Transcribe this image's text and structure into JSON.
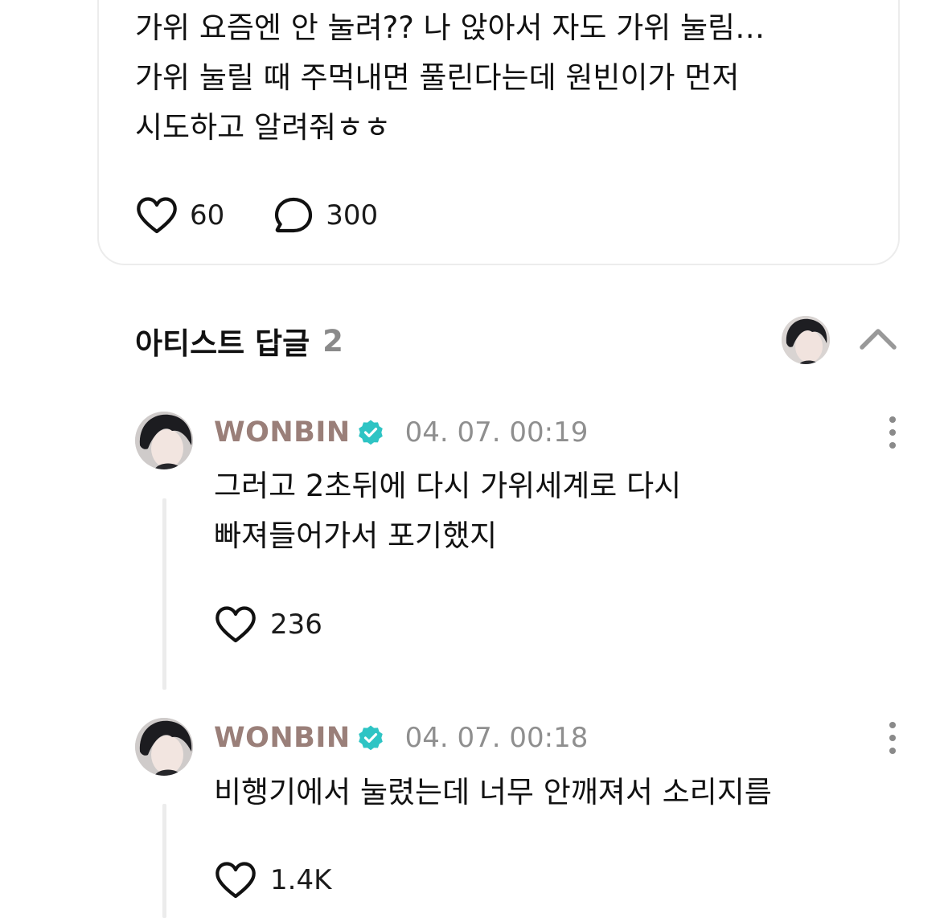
{
  "post": {
    "text": "가위 요즘엔 안 눌려?? 나 앉아서 자도 가위 눌림…\n가위 눌릴 때 주먹내면 풀린다는데 원빈이가 먼저\n시도하고 알려줘ㅎㅎ",
    "likes": "60",
    "comments": "300",
    "avatar_color": "#6fdcc0"
  },
  "replies_section": {
    "title": "아티스트 답글",
    "count": "2"
  },
  "comments": [
    {
      "author": "WONBIN",
      "timestamp": "04. 07. 00:19",
      "text": "그러고 2초뒤에 다시 가위세계로 다시\n빠져들어가서 포기했지",
      "likes": "236"
    },
    {
      "author": "WONBIN",
      "timestamp": "04. 07. 00:18",
      "text": "비행기에서 눌렸는데 너무 안깨져서 소리지름",
      "likes": "1.4K"
    }
  ],
  "colors": {
    "author": "#9a7f79",
    "verified": "#2ec4c4",
    "muted": "#8f8f8f",
    "border": "#ececec"
  },
  "icons": {
    "like": "heart-outline-icon",
    "comment": "speech-bubble-icon",
    "verified": "verified-badge-icon",
    "collapse": "chevron-up-icon",
    "more": "more-vertical-icon"
  }
}
